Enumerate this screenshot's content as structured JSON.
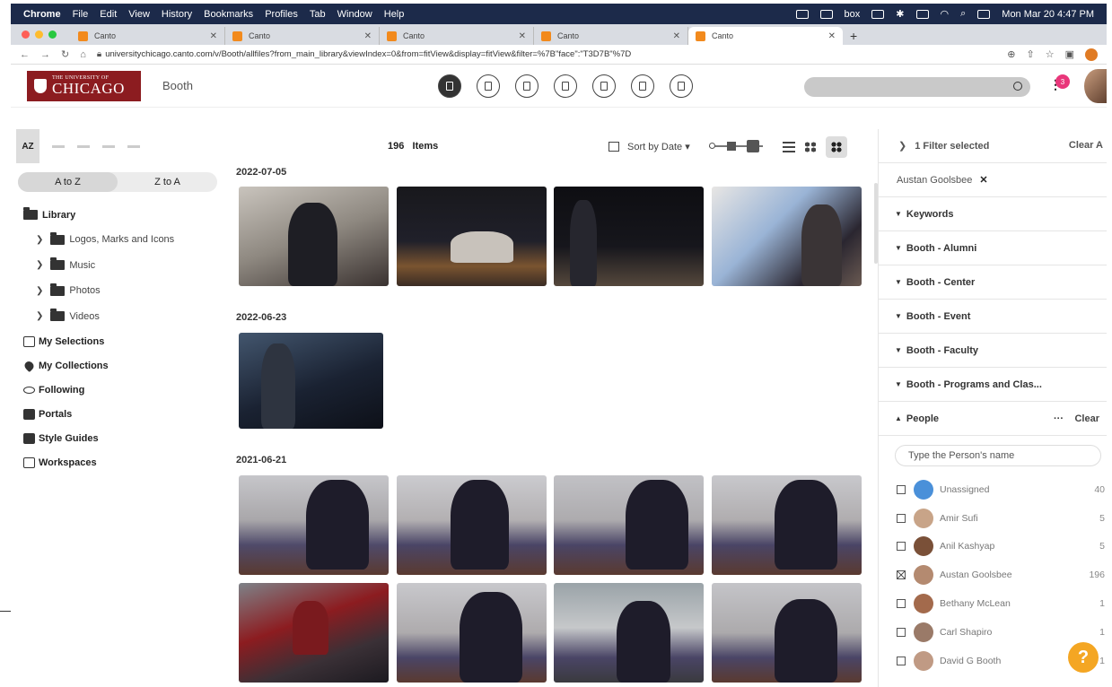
{
  "menubar": {
    "items": [
      "Chrome",
      "File",
      "Edit",
      "View",
      "History",
      "Bookmarks",
      "Profiles",
      "Tab",
      "Window",
      "Help"
    ],
    "box": "box",
    "clock": "Mon Mar 20 4:47 PM"
  },
  "tabs": [
    {
      "title": "Canto"
    },
    {
      "title": "Canto"
    },
    {
      "title": "Canto"
    },
    {
      "title": "Canto"
    },
    {
      "title": "Canto",
      "active": true
    }
  ],
  "address": {
    "url": "universitychicago.canto.com/v/Booth/allfiles?from_main_library&viewIndex=0&from=fitView&display=fitView&filter=%7B\"face\":\"T3D7B\"%7D"
  },
  "header": {
    "logo_small": "THE UNIVERSITY OF",
    "logo_big": "CHICAGO",
    "brand": "Booth",
    "notif_count": "3",
    "colors": {
      "logo": "#8c1c20",
      "notif": "#e9367a",
      "help": "#f4a623"
    }
  },
  "sidebar": {
    "az_label": "AZ",
    "a_to_z": "A to Z",
    "z_to_a": "Z to A",
    "library": "Library",
    "folders": [
      "Logos, Marks and Icons",
      "Music",
      "Photos",
      "Videos"
    ],
    "links": [
      "My Selections",
      "My Collections",
      "Following",
      "Portals",
      "Style Guides",
      "Workspaces"
    ]
  },
  "content": {
    "count": "196",
    "count_label": "Items",
    "sort_label": "Sort by Date",
    "groups": [
      {
        "date": "2022-07-05"
      },
      {
        "date": "2022-06-23"
      },
      {
        "date": "2021-06-21"
      }
    ]
  },
  "filters": {
    "selected": "1 Filter selected",
    "clear_all": "Clear A",
    "chip": "Austan Goolsbee",
    "facets": [
      "Keywords",
      "Booth - Alumni",
      "Booth - Center",
      "Booth - Event",
      "Booth - Faculty",
      "Booth - Programs and Clas..."
    ],
    "people_label": "People",
    "people_clear": "Clear",
    "people_placeholder": "Type the Person's name",
    "people": [
      {
        "name": "Unassigned",
        "count": "40",
        "checked": false
      },
      {
        "name": "Amir Sufi",
        "count": "5",
        "checked": false
      },
      {
        "name": "Anil Kashyap",
        "count": "5",
        "checked": false
      },
      {
        "name": "Austan Goolsbee",
        "count": "196",
        "checked": true
      },
      {
        "name": "Bethany McLean",
        "count": "1",
        "checked": false
      },
      {
        "name": "Carl Shapiro",
        "count": "1",
        "checked": false
      },
      {
        "name": "David G Booth",
        "count": "1",
        "checked": false
      }
    ]
  }
}
